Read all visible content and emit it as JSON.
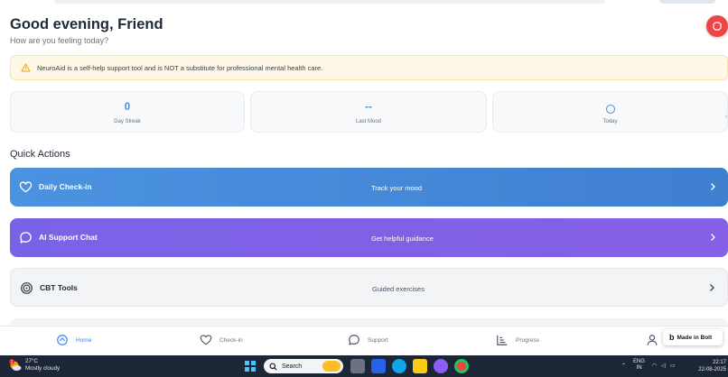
{
  "header": {
    "greeting": "Good evening, Friend",
    "subtitle": "How are you feeling today?"
  },
  "disclaimer": {
    "text": "NeuroAid is a self-help support tool and is NOT a substitute for professional mental health care."
  },
  "stats": [
    {
      "value": "0",
      "label": "Day Streak"
    },
    {
      "value": "--",
      "label": "Last Mood"
    },
    {
      "value": "",
      "label": "Today"
    }
  ],
  "quick_actions": {
    "title": "Quick Actions",
    "items": [
      {
        "title": "Daily Check-in",
        "description": "Track your mood"
      },
      {
        "title": "AI Support Chat",
        "description": "Get helpful guidance"
      },
      {
        "title": "CBT Tools",
        "description": "Guided exercises"
      }
    ]
  },
  "bottom_nav": {
    "items": [
      {
        "label": "Home"
      },
      {
        "label": "Check-in"
      },
      {
        "label": "Support"
      },
      {
        "label": "Progress"
      }
    ]
  },
  "bolt_badge": {
    "label": "Made in Bolt",
    "logo": "b"
  },
  "taskbar": {
    "weather_temp": "27°C",
    "weather_desc": "Mostly cloudy",
    "weather_badge": "1",
    "search_label": "Search",
    "lang_line1": "ENG",
    "lang_line2": "IN",
    "time": "22:17",
    "date": "22-08-2025"
  },
  "colors": {
    "daily_checkin": "#4189d8",
    "ai_support": "#7f62e6",
    "sos": "#ef4444",
    "accent": "#4a8fd6"
  }
}
